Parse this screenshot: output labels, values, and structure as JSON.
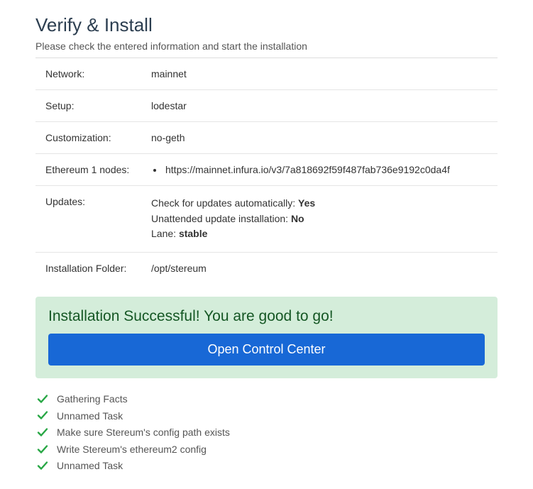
{
  "header": {
    "title": "Verify & Install",
    "subtitle": "Please check the entered information and start the installation"
  },
  "rows": {
    "network": {
      "label": "Network:",
      "value": "mainnet"
    },
    "setup": {
      "label": "Setup:",
      "value": "lodestar"
    },
    "customization": {
      "label": "Customization:",
      "value": "no-geth"
    },
    "eth1": {
      "label": "Ethereum 1 nodes:",
      "items": [
        "https://mainnet.infura.io/v3/7a818692f59f487fab736e9192c0da4f"
      ]
    },
    "updates": {
      "label": "Updates:",
      "auto_label": "Check for updates automatically: ",
      "auto_value": "Yes",
      "unattended_label": "Unattended update installation: ",
      "unattended_value": "No",
      "lane_label": "Lane: ",
      "lane_value": "stable"
    },
    "install_folder": {
      "label": "Installation Folder:",
      "value": "/opt/stereum"
    }
  },
  "success": {
    "title": "Installation Successful! You are good to go!",
    "button": "Open Control Center"
  },
  "tasks": [
    "Gathering Facts",
    "Unnamed Task",
    "Make sure Stereum's config path exists",
    "Write Stereum's ethereum2 config",
    "Unnamed Task"
  ],
  "colors": {
    "check": "#28a745"
  }
}
